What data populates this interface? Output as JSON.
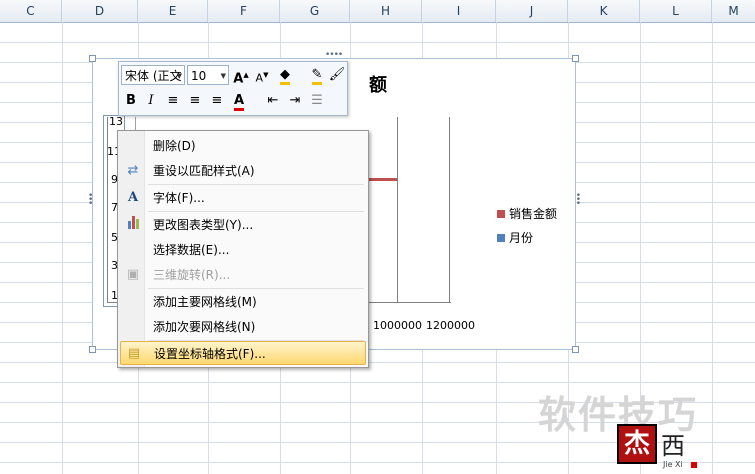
{
  "columns": [
    "C",
    "D",
    "E",
    "F",
    "G",
    "H",
    "I",
    "J",
    "K",
    "L",
    "M"
  ],
  "chart": {
    "title_fragment": "额",
    "y_ticks": [
      "13",
      "11",
      "9",
      "7",
      "5",
      "3",
      "1"
    ],
    "x_ticks": [
      "1000000",
      "1200000"
    ],
    "legend": [
      {
        "label": "销售金额",
        "color": "#c0504d"
      },
      {
        "label": "月份",
        "color": "#4f81bd"
      }
    ]
  },
  "mini_toolbar": {
    "font_name": "宋体 (正文",
    "font_size": "10",
    "grow_font": "A",
    "shrink_font": "A",
    "bold": "B",
    "italic": "I",
    "font_color": "A"
  },
  "context_menu": {
    "items": [
      {
        "label": "删除(D)",
        "icon": "none",
        "disabled": false
      },
      {
        "label": "重设以匹配样式(A)",
        "icon": "reset-style-icon",
        "disabled": false
      },
      {
        "label": "字体(F)...",
        "icon": "font-icon",
        "disabled": false
      },
      {
        "label": "更改图表类型(Y)...",
        "icon": "chart-type-icon",
        "disabled": false
      },
      {
        "label": "选择数据(E)...",
        "icon": "none",
        "disabled": false
      },
      {
        "label": "三维旋转(R)...",
        "icon": "rotate-3d-icon",
        "disabled": true
      },
      {
        "label": "添加主要网格线(M)",
        "icon": "none",
        "disabled": false
      },
      {
        "label": "添加次要网格线(N)",
        "icon": "none",
        "disabled": false
      },
      {
        "label": "设置坐标轴格式(F)...",
        "icon": "format-axis-icon",
        "disabled": false,
        "highlighted": true
      }
    ]
  },
  "watermark": {
    "text": "软件技巧",
    "logo_sub": "Jie Xi"
  }
}
